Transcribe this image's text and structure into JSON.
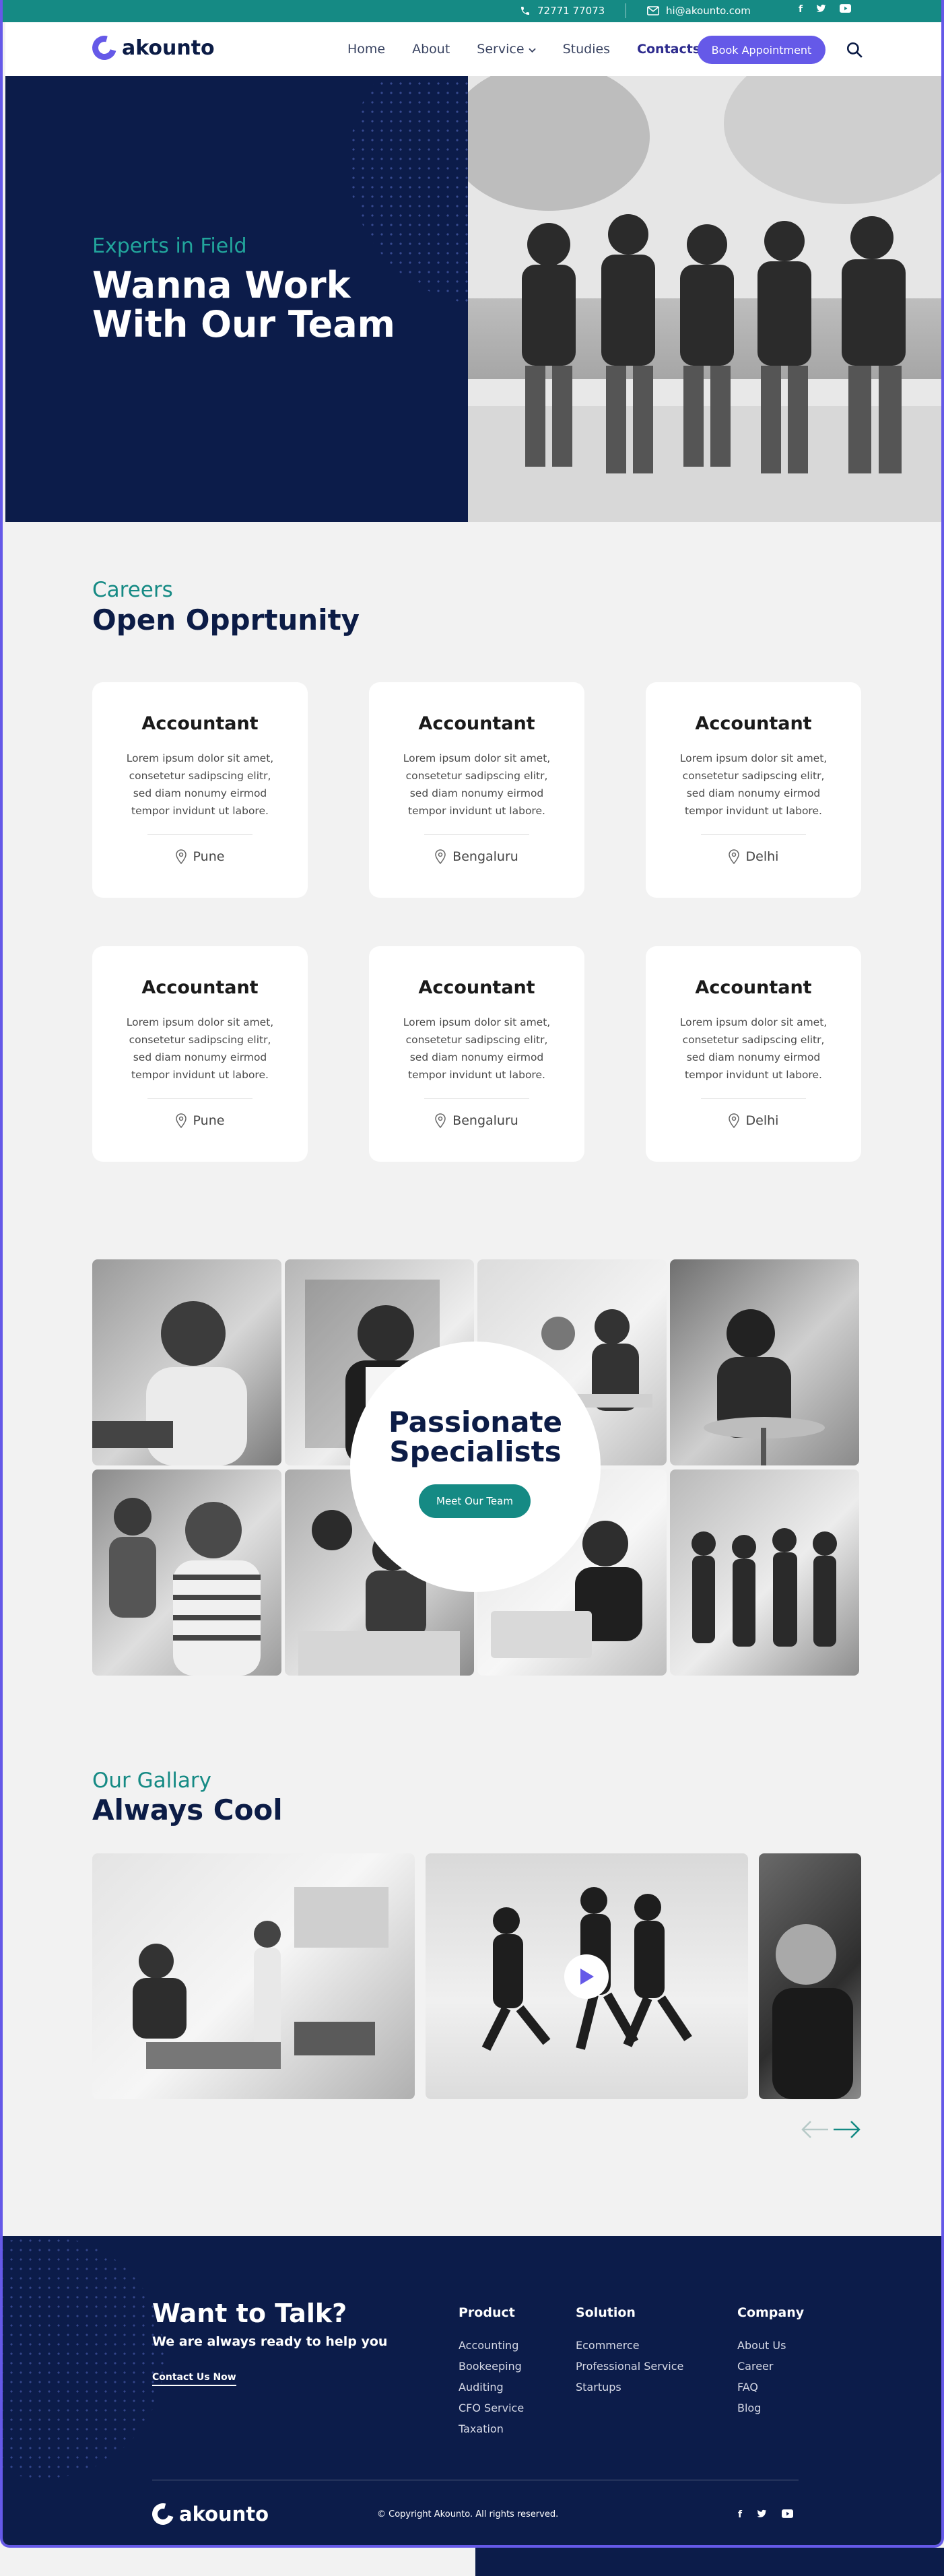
{
  "topbar": {
    "phone": "72771 77073",
    "email": "hi@akounto.com",
    "social": [
      "f",
      "t",
      "yt"
    ]
  },
  "nav": {
    "brand": "akounto",
    "items": [
      "Home",
      "About",
      "Service",
      "Studies",
      "Contacts"
    ],
    "active": "Contacts",
    "cta": "Book Appointment"
  },
  "hero": {
    "subtitle": "Experts in Field",
    "title": "Wanna Work With Our Team"
  },
  "careers": {
    "subtitle": "Careers",
    "title": "Open Opprtunity",
    "jobs": [
      {
        "title": "Accountant",
        "desc": "Lorem ipsum dolor sit amet, consetetur sadipscing elitr, sed diam nonumy eirmod tempor invidunt ut labore.",
        "location": "Pune"
      },
      {
        "title": "Accountant",
        "desc": "Lorem ipsum dolor sit amet, consetetur sadipscing elitr, sed diam nonumy eirmod tempor invidunt ut labore.",
        "location": "Bengaluru"
      },
      {
        "title": "Accountant",
        "desc": "Lorem ipsum dolor sit amet, consetetur sadipscing elitr, sed diam nonumy eirmod tempor invidunt ut labore.",
        "location": "Delhi"
      },
      {
        "title": "Accountant",
        "desc": "Lorem ipsum dolor sit amet, consetetur sadipscing elitr, sed diam nonumy eirmod tempor invidunt ut labore.",
        "location": "Pune"
      },
      {
        "title": "Accountant",
        "desc": "Lorem ipsum dolor sit amet, consetetur sadipscing elitr, sed diam nonumy eirmod tempor invidunt ut labore.",
        "location": "Bengaluru"
      },
      {
        "title": "Accountant",
        "desc": "Lorem ipsum dolor sit amet, consetetur sadipscing elitr, sed diam nonumy eirmod tempor invidunt ut labore.",
        "location": "Delhi"
      }
    ]
  },
  "specialists": {
    "title": "Passionate Specialists",
    "cta": "Meet Our Team"
  },
  "gallery": {
    "subtitle": "Our Gallary",
    "title": "Always Cool"
  },
  "footer": {
    "title": "Want to Talk?",
    "subtitle": "We are always ready to help you",
    "cta": "Contact Us Now",
    "columns": [
      {
        "heading": "Product",
        "items": [
          "Accounting",
          "Bookeeping",
          "Auditing",
          "CFO Service",
          "Taxation"
        ]
      },
      {
        "heading": "Solution",
        "items": [
          "Ecommerce",
          "Professional Service",
          "Startups"
        ]
      },
      {
        "heading": "Company",
        "items": [
          "About Us",
          "Career",
          "FAQ",
          "Blog"
        ]
      }
    ],
    "brand": "akounto",
    "copyright": "© Copyright Akounto. All rights reserved.",
    "social": [
      "f",
      "t",
      "yt"
    ]
  },
  "colors": {
    "primary": "#6559e8",
    "teal": "#158a84",
    "navy": "#0c1c4a",
    "background": "#f2f2f2"
  }
}
